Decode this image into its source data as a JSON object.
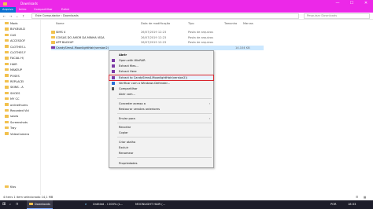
{
  "window": {
    "title": "Downloads",
    "minimize": "—",
    "maximize": "☐",
    "close": "✕"
  },
  "ribbon": {
    "tabs": [
      "Arquivo",
      "Início",
      "Compartilhar",
      "Exibir"
    ]
  },
  "address": {
    "path": "Este Computador  ›  Downloads",
    "search_placeholder": "Pesquisar Downloads"
  },
  "sidebar": {
    "items": [
      "Mods",
      "BUY-BUILD",
      "CAS",
      "ACCESSOF",
      "CLOTHES L",
      "CLOTHES F",
      "FACIAL H/",
      "HAIR",
      "MAKEUP",
      "POSES",
      "REPLACEI",
      "SKINS - A",
      "SHOES",
      "MY CC",
      "onlinethums",
      "Recorded Vid",
      "saves",
      "Screenshots",
      "Tray",
      "VideoCamera",
      "Kiss"
    ]
  },
  "columns": {
    "name": "Nome",
    "date": "Data de modificação",
    "type": "Tipo",
    "size": "Tamanho",
    "markers": "Marcas"
  },
  "files": [
    {
      "name": "SIMS 4",
      "date": "26/07/2019 12:23",
      "type": "Pasta de arquivos",
      "size": ""
    },
    {
      "name": "COISAS DO AMOR DA MINHA VIDA",
      "date": "26/07/2019 12:23",
      "type": "Pasta de arquivos",
      "size": ""
    },
    {
      "name": "APP BACKUP",
      "date": "26/07/2019 12:23",
      "type": "Pasta de arquivos",
      "size": ""
    },
    {
      "name": "CandySims4-MoonlightHair(version2)",
      "date": "",
      "type": "",
      "size": "14.104 KB"
    }
  ],
  "context_menu": {
    "items": [
      {
        "label": "Abrir"
      },
      {
        "label": "Open with WinRAR"
      },
      {
        "label": "Extract files..."
      },
      {
        "label": "Extract Here"
      },
      {
        "label": "Extract to CandySims4-MoonlightHair(version2)\\"
      },
      {
        "label": "Verificar com o Windows Defender..."
      },
      {
        "label": "Compartilhar"
      },
      {
        "label": "Abrir com..."
      },
      {
        "label": "Conceder acesso a"
      },
      {
        "label": "Restaurar versões anteriores"
      },
      {
        "label": "Enviar para"
      },
      {
        "label": "Recortar"
      },
      {
        "label": "Copiar"
      },
      {
        "label": "Criar atalho"
      },
      {
        "label": "Excluir"
      },
      {
        "label": "Renomear"
      },
      {
        "label": "Propriedades"
      }
    ]
  },
  "status": {
    "text": "4 itens   1 item selecionado  14,1 MB"
  },
  "taskbar": {
    "items": [
      "Downloads",
      "Untitled - I 200% (L...",
      "MOONLIGHT HAIR (...",
      "POR",
      "18:33"
    ]
  },
  "colors": {
    "accent": "#ec28e8",
    "selection": "#cce8ff",
    "highlight_border": "#d9242b"
  }
}
